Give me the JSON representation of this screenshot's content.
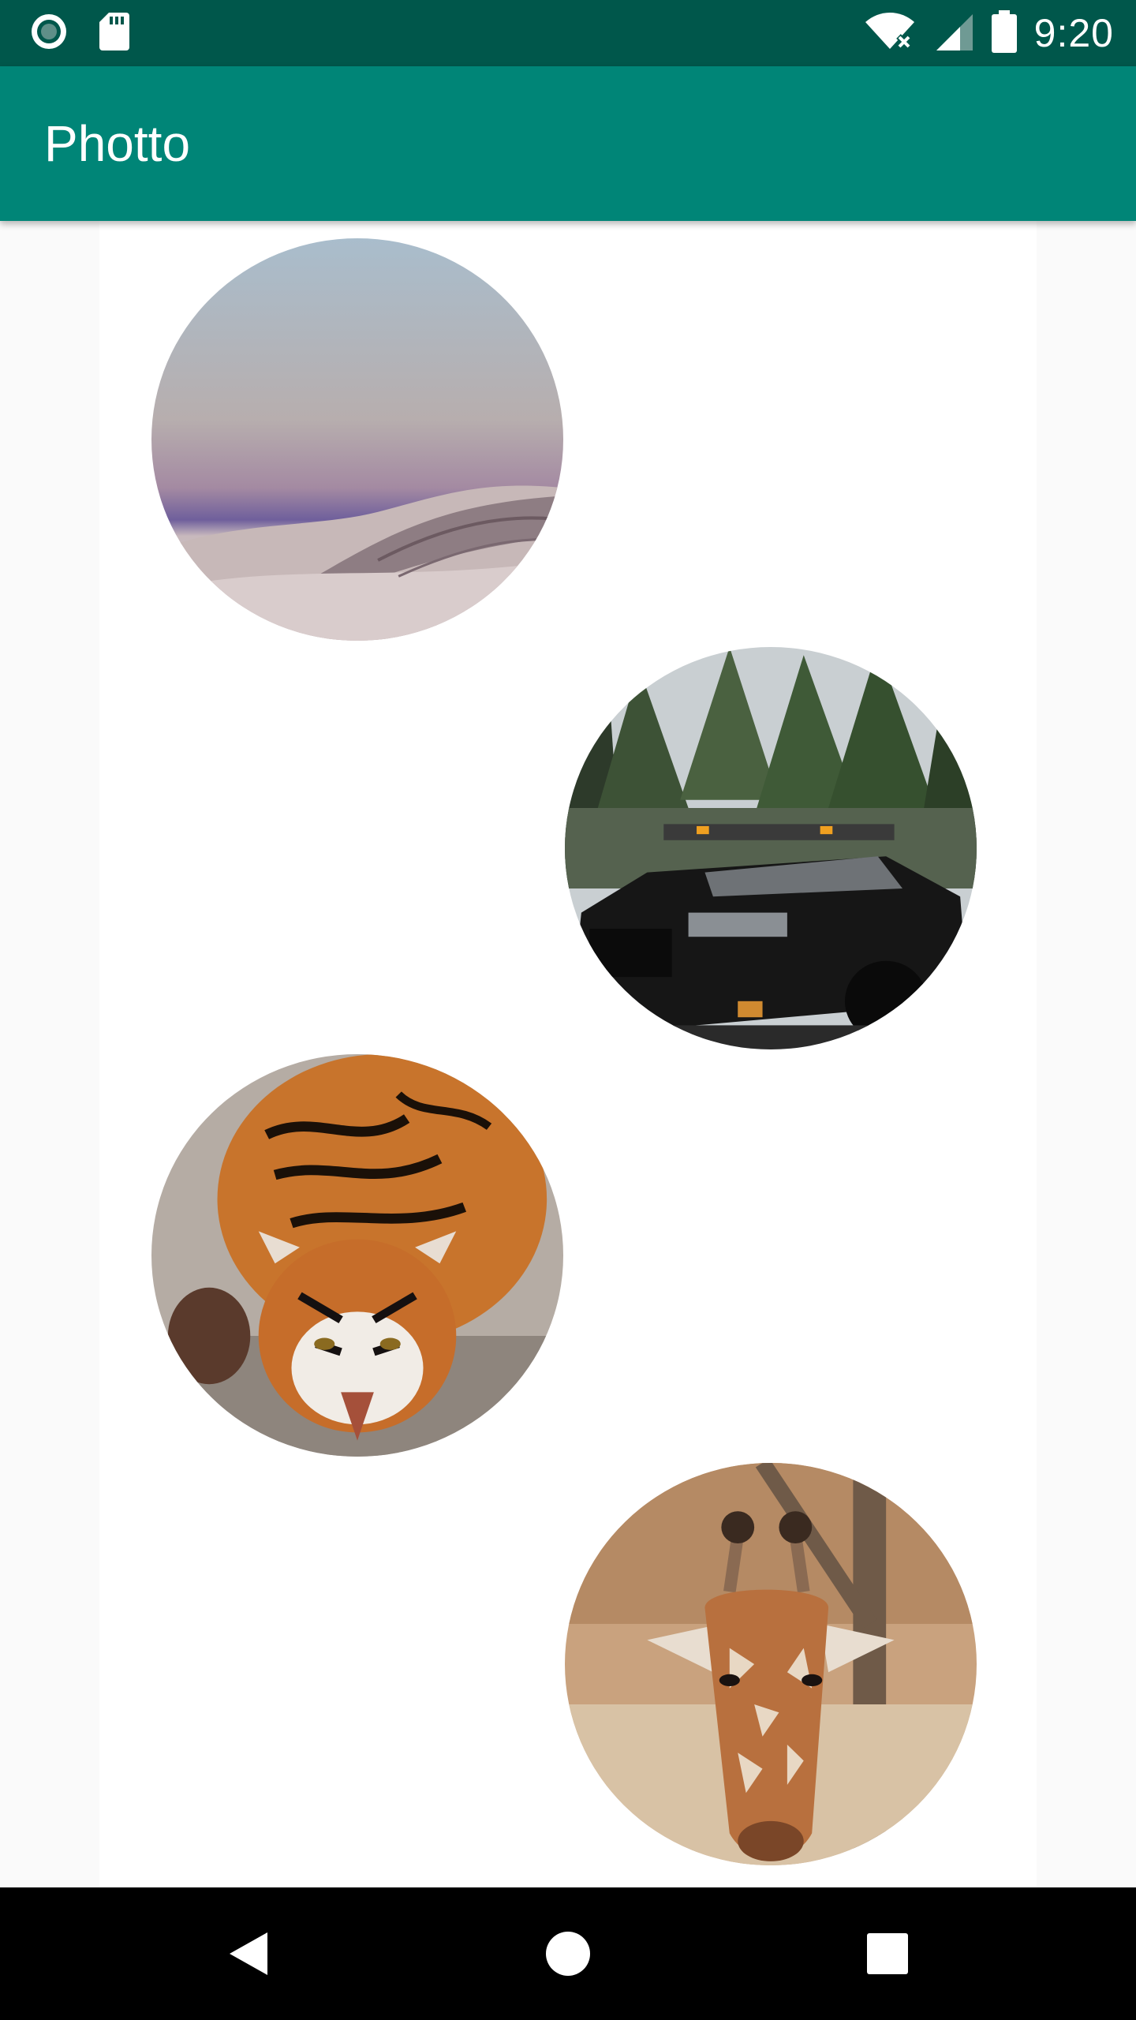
{
  "status_bar": {
    "time": "9:20",
    "left_icons": [
      "radio-icon",
      "sd-card-icon"
    ],
    "right_icons": [
      "wifi-off-icon",
      "cellular-signal-icon",
      "battery-icon"
    ]
  },
  "app_bar": {
    "title": "Photto"
  },
  "photos": [
    {
      "subject": "desert-dunes-photo"
    },
    {
      "subject": "black-truck-photo"
    },
    {
      "subject": "tiger-photo"
    },
    {
      "subject": "giraffe-photo"
    }
  ],
  "nav_bar": {
    "buttons": [
      "back-icon",
      "home-icon",
      "recents-icon"
    ]
  },
  "colors": {
    "status_bar": "#00574b",
    "app_bar": "#008577",
    "background": "#fafafa",
    "panel": "#ffffff",
    "nav_bar": "#000000"
  }
}
